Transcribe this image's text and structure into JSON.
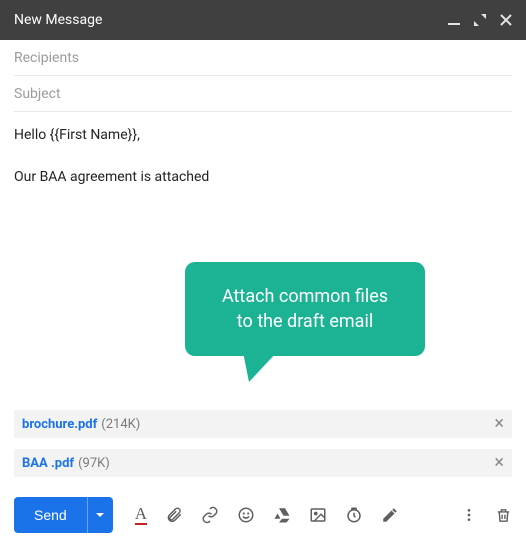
{
  "window": {
    "title": "New Message"
  },
  "fields": {
    "recipients_placeholder": "Recipients",
    "subject_placeholder": "Subject"
  },
  "body": {
    "line1": "Hello {{First Name}},",
    "line2": "Our BAA agreement is attached"
  },
  "callout": {
    "line1": "Attach common files",
    "line2": "to the draft email"
  },
  "attachments": [
    {
      "name": "brochure.pdf",
      "size": "(214K)"
    },
    {
      "name": "BAA .pdf",
      "size": "(97K)"
    }
  ],
  "toolbar": {
    "send_label": "Send"
  }
}
